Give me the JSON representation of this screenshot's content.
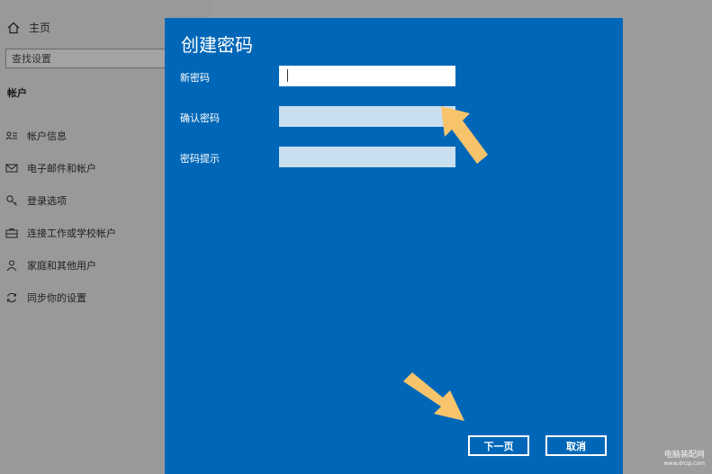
{
  "sidebar": {
    "home_label": "主页",
    "search_placeholder": "查找设置",
    "section_title": "帐户",
    "items": [
      {
        "label": "帐户信息",
        "icon": "account-info-icon"
      },
      {
        "label": "电子邮件和帐户",
        "icon": "mail-icon"
      },
      {
        "label": "登录选项",
        "icon": "key-icon"
      },
      {
        "label": "连接工作或学校帐户",
        "icon": "briefcase-icon"
      },
      {
        "label": "家庭和其他用户",
        "icon": "person-icon"
      },
      {
        "label": "同步你的设置",
        "icon": "sync-icon"
      }
    ]
  },
  "dialog": {
    "title": "创建密码",
    "fields": {
      "new_password": {
        "label": "新密码",
        "value": ""
      },
      "confirm_password": {
        "label": "确认密码",
        "value": ""
      },
      "password_hint": {
        "label": "密码提示",
        "value": ""
      }
    },
    "next_label": "下一页",
    "cancel_label": "取消",
    "accent_color": "#0067b8"
  },
  "annotation": {
    "arrow_color": "#f7c46c"
  },
  "watermark": {
    "line1": "电脑装配网",
    "line2": "www.dnzp.com"
  }
}
